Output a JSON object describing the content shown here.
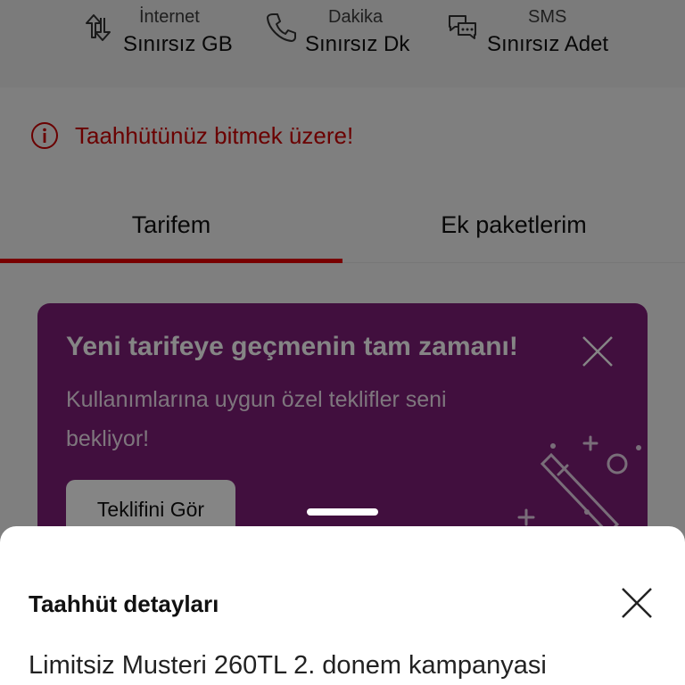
{
  "usage": {
    "items": [
      {
        "title": "İnternet",
        "value": "Sınırsız GB",
        "icon": "data-transfer-icon"
      },
      {
        "title": "Dakika",
        "value": "Sınırsız Dk",
        "icon": "phone-icon"
      },
      {
        "title": "SMS",
        "value": "Sınırsız Adet",
        "icon": "message-bubbles-icon"
      }
    ]
  },
  "warning": {
    "text": "Taahhütünüz bitmek üzere!",
    "icon": "info-circle-icon",
    "color": "#cc0000"
  },
  "tabs": [
    {
      "label": "Tarifem",
      "active": true
    },
    {
      "label": "Ek paketlerim",
      "active": false
    }
  ],
  "promo": {
    "title": "Yeni tarifeye geçmenin tam zamanı!",
    "text": "Kullanımlarına uygun özel teklifler seni bekliyor!",
    "button_label": "Teklifini Gör",
    "close_icon": "close-icon",
    "illustration_icon": "magic-wand-icon",
    "background_color": "#7e1e78"
  },
  "sheet": {
    "title": "Taahhüt detayları",
    "detail": "Limitsiz Musteri 260TL 2. donem kampanyasi",
    "close_icon": "close-icon"
  },
  "colors": {
    "brand_red": "#e60000",
    "overlay": "rgba(0,0,0,0.48)"
  }
}
